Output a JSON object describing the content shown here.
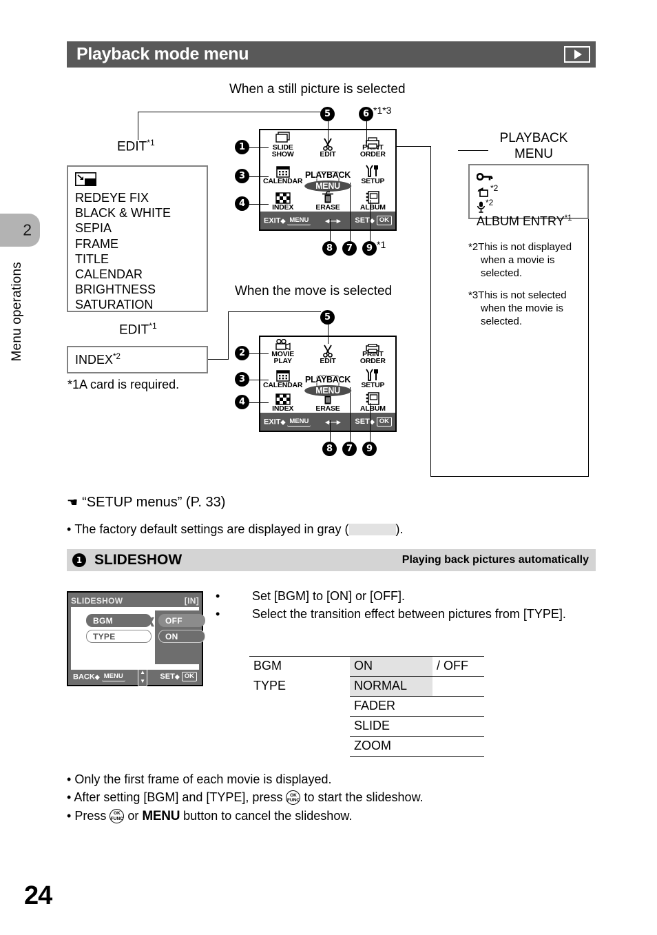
{
  "page": {
    "number": "24",
    "chapter_tab": "2",
    "chapter_label": "Menu operations"
  },
  "header": {
    "title": "Playback mode menu",
    "mode_icon": "playback-icon"
  },
  "diagram": {
    "still_caption": "When a still picture is selected",
    "movie_caption": "When the move is selected",
    "edit_label": "EDIT",
    "edit_label_sup": "*1",
    "playback_menu_label_line1": "PLAYBACK",
    "playback_menu_label_line2": "MENU",
    "card_note": "*1A card is required.",
    "note2": "*2This is not displayed when a movie is selected.",
    "note3": "*3This is not selected when the movie is selected.",
    "callout_6_sup": "*1*3",
    "callout_9_sup": "*1",
    "edit_list": [
      {
        "text": "",
        "icon": "resize-icon"
      },
      {
        "text": "REDEYE FIX"
      },
      {
        "text": "BLACK & WHITE"
      },
      {
        "text": "SEPIA"
      },
      {
        "text": "FRAME"
      },
      {
        "text": "TITLE"
      },
      {
        "text": "CALENDAR"
      },
      {
        "text": "BRIGHTNESS"
      },
      {
        "text": "SATURATION"
      }
    ],
    "index_list": [
      {
        "text": "INDEX",
        "sup": "*2"
      }
    ],
    "playback_menu_list": [
      {
        "text": "",
        "icon": "key-icon",
        "sup": ""
      },
      {
        "text": "",
        "icon": "rotate-icon",
        "sup": "*2"
      },
      {
        "text": "",
        "icon": "microphone-icon",
        "sup": "*2"
      },
      {
        "text": "ALBUM ENTRY",
        "sup": "*1"
      }
    ],
    "lcd_still": {
      "cells": [
        {
          "label_line1": "SLIDE",
          "label_line2": "SHOW",
          "icon": "slideshow-icon"
        },
        {
          "label_line1": "EDIT",
          "label_line2": "",
          "icon": "scissors-icon"
        },
        {
          "label_line1": "PRINT",
          "label_line2": "ORDER",
          "icon": "print-icon"
        },
        {
          "label_line1": "CALENDAR",
          "label_line2": "",
          "icon": "calendar-icon"
        },
        {
          "label_line1": "",
          "label_line2": "",
          "icon": "playback-menu-icon"
        },
        {
          "label_line1": "SETUP",
          "label_line2": "",
          "icon": "wrench-icon"
        },
        {
          "label_line1": "INDEX",
          "label_line2": "",
          "icon": "index-icon"
        },
        {
          "label_line1": "ERASE",
          "label_line2": "",
          "icon": "trash-icon"
        },
        {
          "label_line1": "ALBUM",
          "label_line2": "",
          "icon": "album-icon"
        }
      ],
      "bar_exit": "EXIT",
      "bar_exit_key": "MENU",
      "bar_set": "SET",
      "bar_set_key": "OK"
    },
    "lcd_movie": {
      "cells": [
        {
          "label_line1": "MOVIE",
          "label_line2": "PLAY",
          "icon": "movie-icon"
        },
        {
          "label_line1": "EDIT",
          "label_line2": "",
          "icon": "scissors-icon"
        },
        {
          "label_line1": "PRINT",
          "label_line2": "ORDER",
          "icon": "print-icon"
        },
        {
          "label_line1": "CALENDAR",
          "label_line2": "",
          "icon": "calendar-icon"
        },
        {
          "label_line1": "",
          "label_line2": "",
          "icon": "playback-menu-icon"
        },
        {
          "label_line1": "SETUP",
          "label_line2": "",
          "icon": "wrench-icon"
        },
        {
          "label_line1": "INDEX",
          "label_line2": "",
          "icon": "index-icon"
        },
        {
          "label_line1": "ERASE",
          "label_line2": "",
          "icon": "trash-icon"
        },
        {
          "label_line1": "ALBUM",
          "label_line2": "",
          "icon": "album-icon"
        }
      ],
      "bar_exit": "EXIT",
      "bar_exit_key": "MENU",
      "bar_set": "SET",
      "bar_set_key": "OK"
    },
    "playback_menu_heading_line1": "PLAYBACK",
    "playback_menu_heading_line2": "MENU",
    "callouts": [
      "1",
      "2",
      "3",
      "4",
      "5",
      "6",
      "7",
      "8",
      "9"
    ]
  },
  "reference": {
    "pointer_icon": "hand-pointer-icon",
    "text": "“SETUP menus” (P. 33)",
    "gray_note_before": "The factory default settings are displayed in gray (",
    "gray_note_after": ")."
  },
  "section": {
    "number": "1",
    "title": "SLIDESHOW",
    "subtitle": "Playing back pictures automatically"
  },
  "slideshow_lcd": {
    "title": "SLIDESHOW",
    "location": "[IN]",
    "items": [
      {
        "label": "BGM",
        "selected": true
      },
      {
        "label": "TYPE",
        "selected": false
      }
    ],
    "options": [
      {
        "label": "OFF",
        "highlighted": true
      },
      {
        "label": "ON",
        "highlighted": false
      }
    ],
    "back_label": "BACK",
    "back_key": "MENU",
    "set_label": "SET",
    "set_key": "OK"
  },
  "instructions": [
    "Set [BGM] to [ON] or [OFF].",
    "Select the transition effect between pictures from [TYPE]."
  ],
  "settings_table": {
    "rows": [
      {
        "label": "BGM",
        "value": "ON",
        "value_highlighted": true,
        "extra": "/ OFF"
      },
      {
        "label": "TYPE",
        "value": "NORMAL",
        "value_highlighted": true,
        "extra": ""
      },
      {
        "label": "",
        "value": "FADER",
        "value_highlighted": false,
        "extra": ""
      },
      {
        "label": "",
        "value": "SLIDE",
        "value_highlighted": false,
        "extra": ""
      },
      {
        "label": "",
        "value": "ZOOM",
        "value_highlighted": false,
        "extra": ""
      }
    ]
  },
  "bottom_bullets": {
    "b1": "Only the first frame of each movie is displayed.",
    "b2_pre": "After setting [BGM] and [TYPE], press",
    "b2_post": "to start the slideshow.",
    "b3_pre": "Press",
    "b3_mid": "or",
    "b3_menu": "MENU",
    "b3_post": "button to cancel the slideshow."
  }
}
